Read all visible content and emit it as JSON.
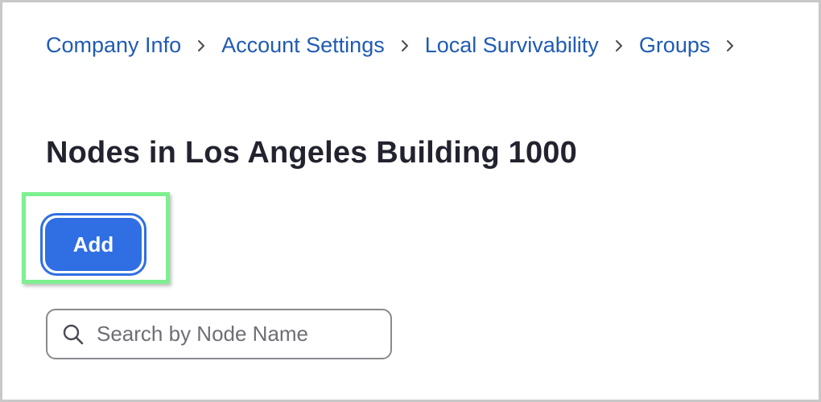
{
  "breadcrumb": {
    "items": [
      {
        "label": "Company Info"
      },
      {
        "label": "Account Settings"
      },
      {
        "label": "Local Survivability"
      },
      {
        "label": "Groups"
      }
    ],
    "separator_icon": "chevron-right-icon"
  },
  "page": {
    "title": "Nodes in Los Angeles Building 1000"
  },
  "actions": {
    "add_label": "Add"
  },
  "search": {
    "placeholder": "Search by Node Name",
    "value": "",
    "icon": "search-icon"
  },
  "colors": {
    "link": "#1f5bb4",
    "primary": "#2f6fe3",
    "title": "#23232f",
    "highlight": "#7ef08f"
  }
}
